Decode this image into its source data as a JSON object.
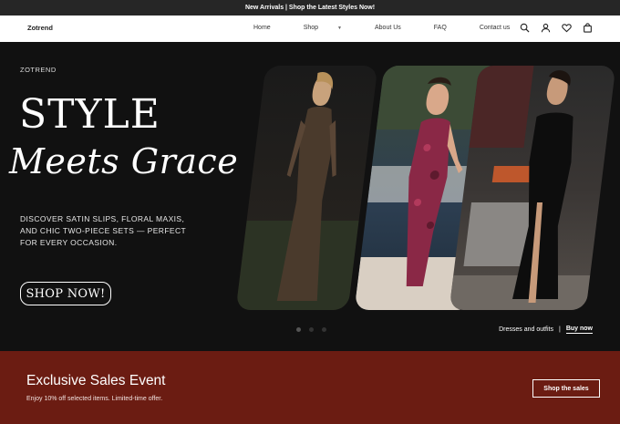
{
  "announcement": {
    "text": "New Arrivals | Shop the Latest Styles Now!"
  },
  "header": {
    "logo": "Zotrend",
    "menu": [
      {
        "label": "Home"
      },
      {
        "label": "Shop",
        "has_dropdown": true
      },
      {
        "label": "About Us"
      },
      {
        "label": "FAQ"
      },
      {
        "label": "Contact us"
      }
    ],
    "icons": [
      "search-icon",
      "account-icon",
      "wishlist-heart-icon",
      "cart-bag-icon"
    ]
  },
  "hero": {
    "brand": "ZOTREND",
    "headline_line1": "STYLE",
    "headline_line2": "Meets Grace",
    "description": "DISCOVER SATIN SLIPS, FLORAL MAXIS, AND CHIC TWO-PIECE SETS — PERFECT FOR EVERY OCCASION.",
    "cta_label": "SHOP NOW!",
    "slide_count": 3,
    "active_slide": 0,
    "caption_text": "Dresses and outfits",
    "caption_separator": "|",
    "caption_link": "Buy now"
  },
  "promo": {
    "title": "Exclusive Sales Event",
    "subtitle": "Enjoy 10% off selected items. Limited-time offer.",
    "button_label": "Shop the sales"
  },
  "colors": {
    "announcement_bg": "#262626",
    "hero_bg": "#111111",
    "promo_bg": "#6b1c12"
  }
}
